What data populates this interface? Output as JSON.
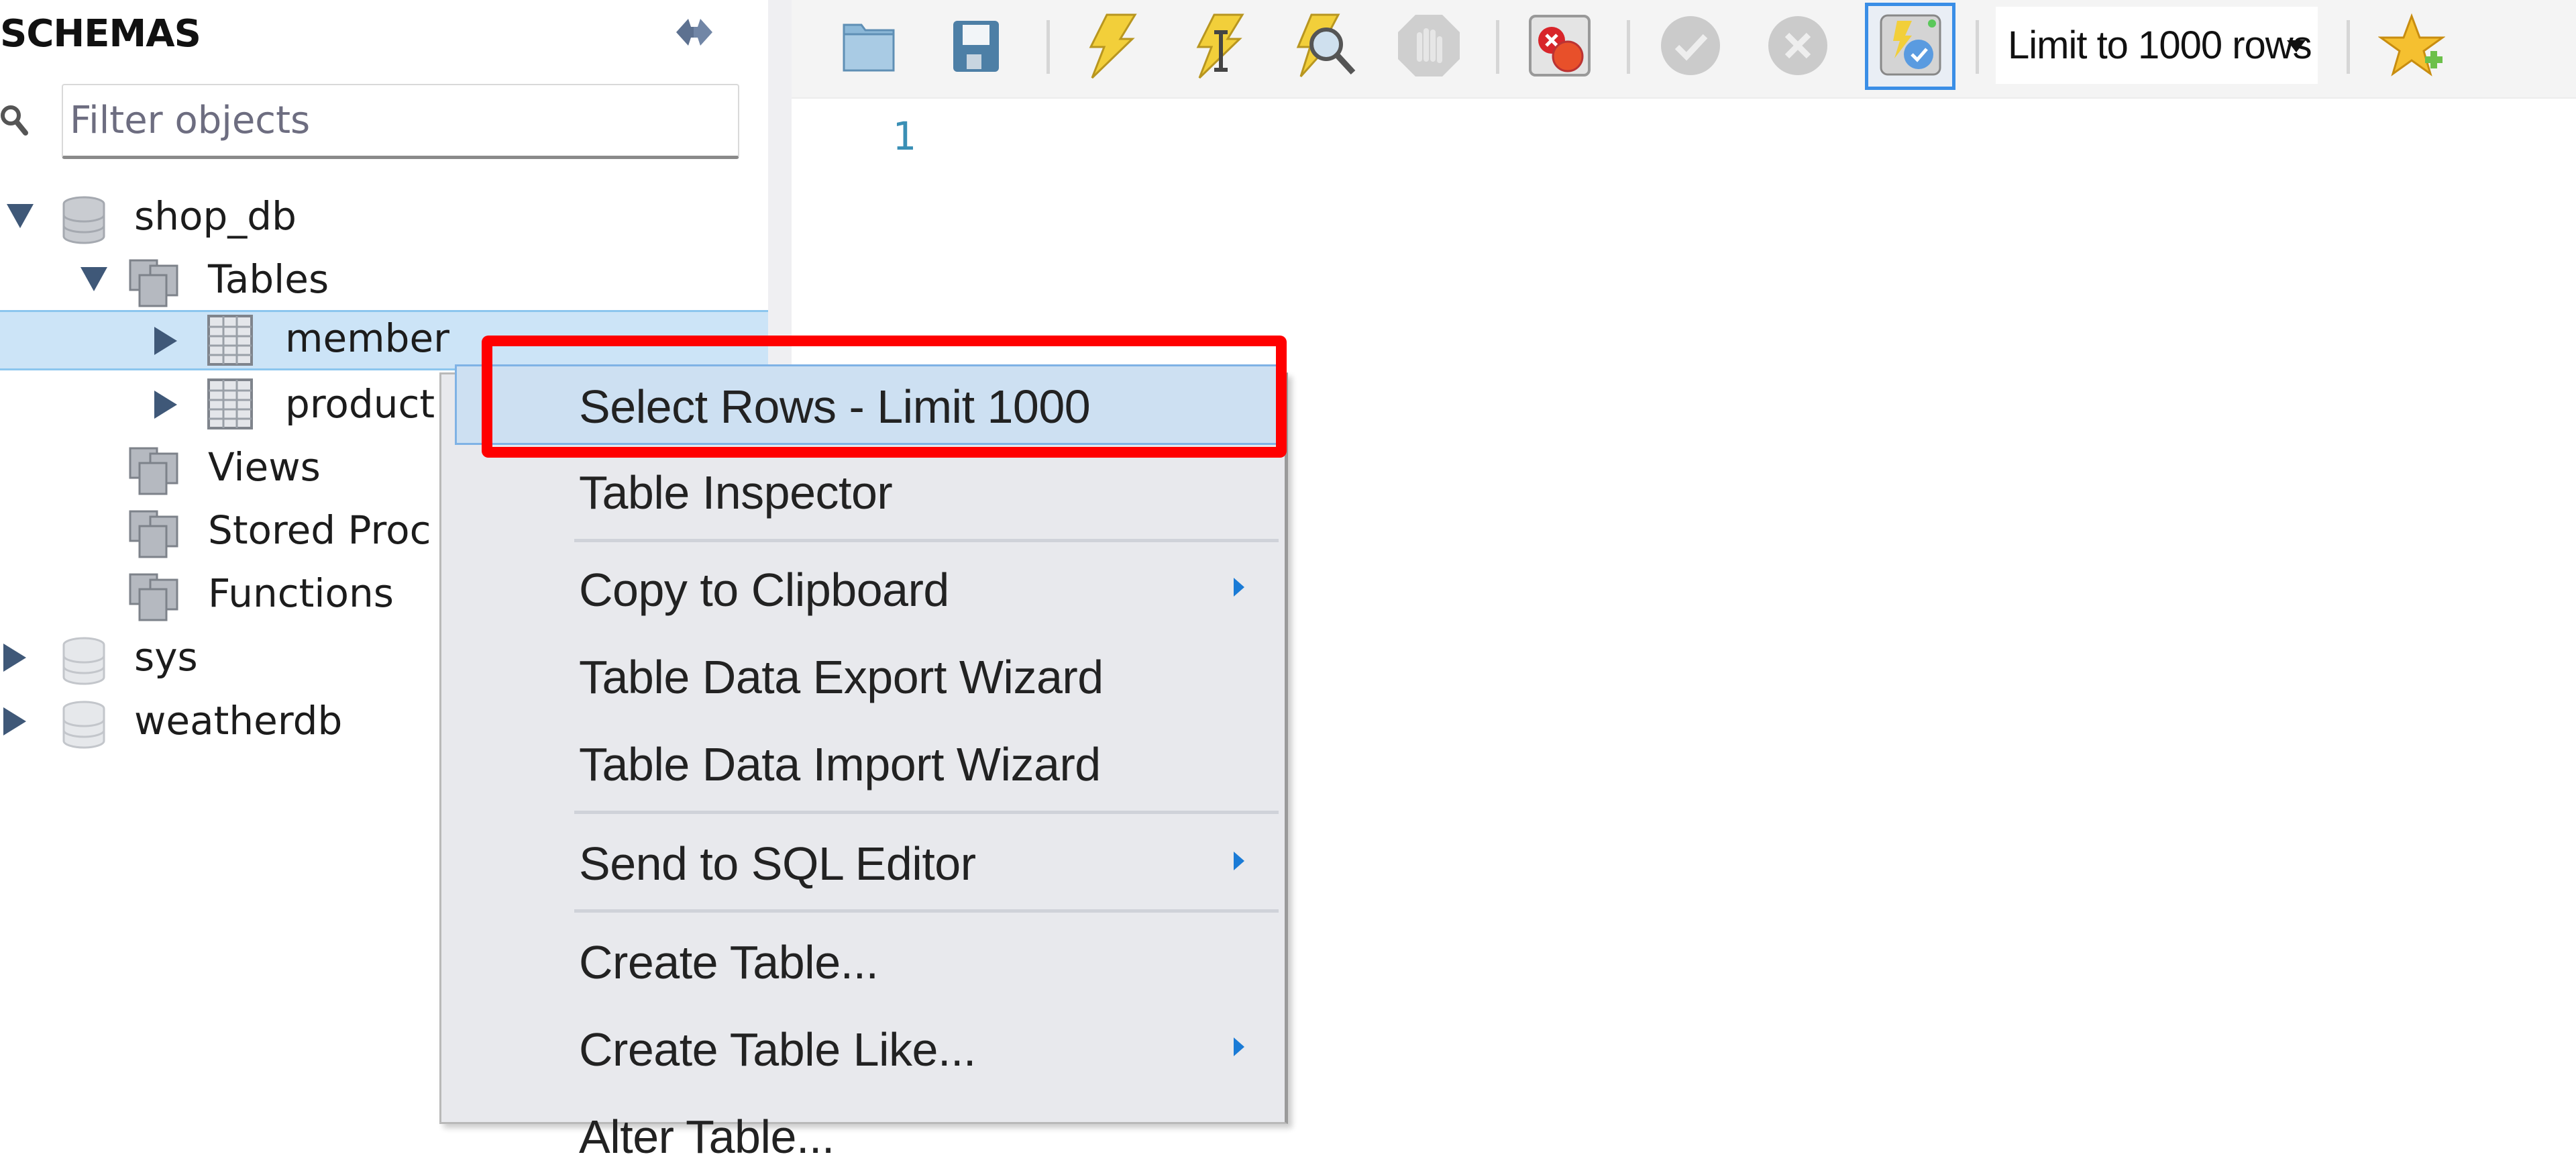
{
  "sidebar": {
    "title": "SCHEMAS",
    "refresh_icon": "refresh-icon",
    "filter": {
      "placeholder": "Filter objects",
      "value": ""
    },
    "tree": [
      {
        "label": "shop_db",
        "level": 0,
        "expanded": true,
        "icon": "database-icon"
      },
      {
        "label": "Tables",
        "level": 1,
        "expanded": true,
        "icon": "folder-group-icon"
      },
      {
        "label": "member",
        "level": 2,
        "expanded": false,
        "icon": "table-icon",
        "selected": true
      },
      {
        "label": "product",
        "level": 2,
        "expanded": false,
        "icon": "table-icon"
      },
      {
        "label": "Views",
        "level": 1,
        "icon": "folder-group-icon"
      },
      {
        "label": "Stored Procedures",
        "visible_label": "Stored Proc",
        "level": 1,
        "icon": "folder-group-icon"
      },
      {
        "label": "Functions",
        "level": 1,
        "icon": "folder-group-icon"
      },
      {
        "label": "sys",
        "level": 0,
        "expanded": false,
        "icon": "database-icon"
      },
      {
        "label": "weatherdb",
        "level": 0,
        "expanded": false,
        "icon": "database-icon"
      }
    ]
  },
  "toolbar": {
    "buttons": [
      {
        "name": "open-sql-file",
        "icon": "folder-icon"
      },
      {
        "name": "save-sql-file",
        "icon": "floppy-disk-icon"
      },
      {
        "name": "execute",
        "icon": "lightning-icon"
      },
      {
        "name": "execute-current-statement",
        "icon": "lightning-cursor-icon"
      },
      {
        "name": "explain",
        "icon": "lightning-magnifier-icon"
      },
      {
        "name": "stop",
        "icon": "stop-hand-icon",
        "disabled": true
      },
      {
        "name": "toggle-stop-on-error",
        "icon": "error-stop-icon"
      },
      {
        "name": "commit",
        "icon": "check-circle-icon",
        "disabled": true
      },
      {
        "name": "rollback",
        "icon": "x-circle-icon",
        "disabled": true
      },
      {
        "name": "toggle-autocommit",
        "icon": "autocommit-icon",
        "active": true
      },
      {
        "name": "add-snippet",
        "icon": "star-icon"
      }
    ],
    "limit_select": {
      "value": "Limit to 1000 rows"
    }
  },
  "editor": {
    "line_numbers": [
      "1"
    ],
    "content": ""
  },
  "context_menu": {
    "items": [
      {
        "label": "Select Rows - Limit 1000",
        "highlighted": true,
        "annotated": true
      },
      {
        "label": "Table Inspector"
      },
      {
        "separator": true
      },
      {
        "label": "Copy to Clipboard",
        "submenu": true
      },
      {
        "label": "Table Data Export Wizard"
      },
      {
        "label": "Table Data Import Wizard"
      },
      {
        "separator": true
      },
      {
        "label": "Send to SQL Editor",
        "submenu": true
      },
      {
        "separator": true
      },
      {
        "label": "Create Table..."
      },
      {
        "label": "Create Table Like...",
        "submenu": true
      },
      {
        "label": "Alter Table..."
      }
    ]
  },
  "colors": {
    "annotation_red": "#ff0000",
    "selection_blue": "#cce4f7",
    "submenu_arrow": "#1a7bd6",
    "line_number": "#3a8fb5"
  }
}
